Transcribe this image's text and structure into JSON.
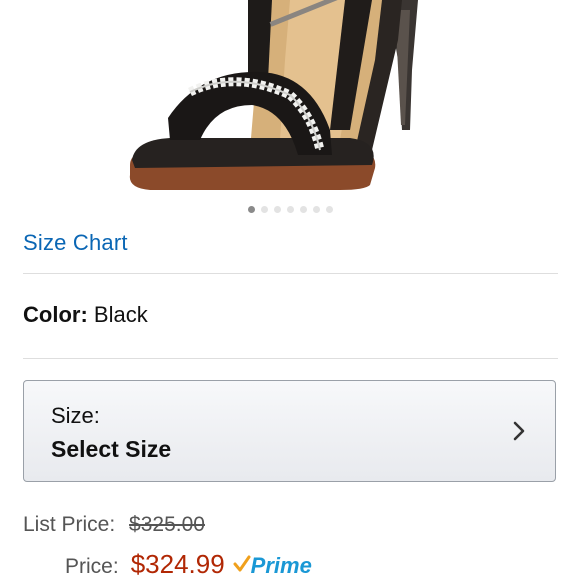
{
  "product": {
    "image_name": "black strappy high-heel sandal with white braided strap",
    "carousel": {
      "count": 7,
      "active_index": 0
    }
  },
  "links": {
    "size_chart": "Size Chart"
  },
  "color": {
    "label": "Color:",
    "value": "Black"
  },
  "size": {
    "label": "Size:",
    "value": "Select Size",
    "icon": "chevron-right-icon"
  },
  "pricing": {
    "list_price_label": "List Price:",
    "list_price_value": "$325.00",
    "price_label": "Price:",
    "price_value": "$324.99",
    "prime_label": "Prime"
  },
  "colors": {
    "link": "#0a66b4",
    "price": "#b12704",
    "prime": "#1a98d5"
  }
}
